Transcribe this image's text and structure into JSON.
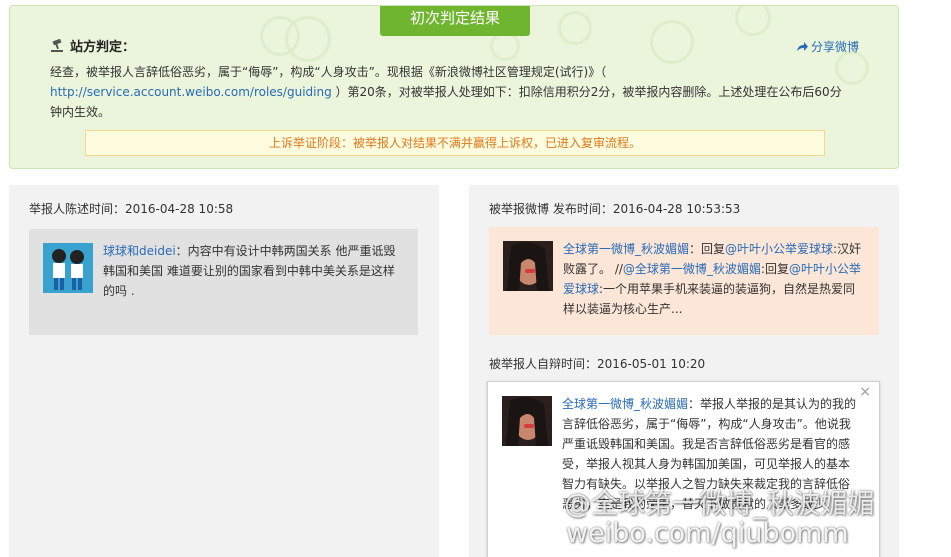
{
  "verdict": {
    "tab_label": "初次判定结果",
    "heading": "站方判定：",
    "share_label": "分享微博",
    "text_part1": "经查，被举报人言辞低俗恶劣，属于“侮辱”，构成“人身攻击”。现根据《新浪微博社区管理规定(试行)》（ ",
    "link_text": "http://service.account.weibo.com/roles/guiding",
    "text_part2": " ）第20条，对被举报人处理如下：扣除信用积分2分，被举报内容删除。上述处理在公布后60分钟内生效。",
    "appeal_notice": "上诉举证阶段：被举报人对结果不满并赢得上诉权，已进入复审流程。"
  },
  "reporter": {
    "label": "举报人陈述时间：2016-04-28 10:58",
    "username": "球球和deidei",
    "statement": "：内容中有设计中韩两国关系 他严重诋毁韩国和美国 难道要让别的国家看到中韩中美关系是这样的吗 ."
  },
  "reported_post": {
    "label": "被举报微博 发布时间：2016-04-28 10:53:53",
    "username": "全球第一微博_秋波媚媚",
    "reply_prefix": "：回复",
    "reply_target1": "@叶叶小公举爱球球",
    "reply_text1": ":汉奸败露了。 //",
    "quoted_user": "@全球第一微博_秋波媚媚",
    "reply_prefix2": ":回复",
    "reply_target2": "@叶叶小公举爱球球",
    "reply_text2": ":一个用苹果手机来装逼的装逼狗，自然是热爱同样以装逼为核心生产..."
  },
  "defense": {
    "label": "被举报人自辩时间：2016-05-01 10:20",
    "username": "全球第一微博_秋波媚媚",
    "text": "：举报人举报的是其认为的我的言辞低俗恶劣，属于“侮辱”，构成“人身攻击”。他说我严重诋毁韩国和美国。我是否言辞低俗恶劣是看官的感受，举报人视其人身为韩国加美国，可见举报人的基本智力有缺失。以举报人之智力缺失来裁定我的言辞低俗恶劣，实是我的荣幸，替天下做贡献的人或多或少...",
    "close_label": "×"
  },
  "watermark": {
    "line1": "@全球第一微博_秋波媚媚",
    "line2": "weibo.com/qiubomm"
  },
  "colors": {
    "accent_green": "#6fb52f",
    "link_blue": "#2a6bb7",
    "appeal_orange": "#e07a1b"
  }
}
